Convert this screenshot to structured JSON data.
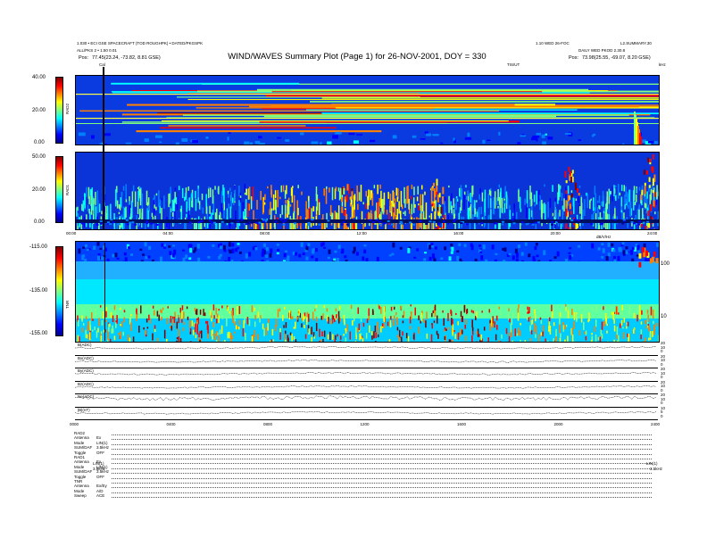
{
  "header": {
    "title": "WIND/WAVES Summary Plot (Page 1) for 26-NOV-2001, DOY = 330",
    "top_left_line1": "1.030 • ECI GSE SPACECRAFT (TOD ROUGHPK) • DATED/PKGSPK",
    "top_left_line2": "ALL/PKS 2 • 1.50 0.01",
    "pos_left_label": "Pos:",
    "pos_left_value": "77.45(23.24, -73.82, 8.81 GSE)",
    "top_right_line1": "1.10 WED 26-FOC",
    "top_right_line1b": "L2.SUMMARY.30",
    "top_right_line2": "DAILY WED PKOD 2.30.8",
    "pos_right_label": "Pos:",
    "pos_right_value": "73.98(25.55, -69.07, 8.20 GSE)",
    "cal_label": "Cal",
    "ticker_label": "TIS/UT",
    "right_unit": "kHz",
    "rad2_right_unit": "MHz"
  },
  "colors": {
    "spectrum": [
      "#00008f",
      "#0000ff",
      "#0080ff",
      "#00ffff",
      "#80ff80",
      "#ffff00",
      "#ff8000",
      "#ff0000",
      "#800000"
    ],
    "panel_bg": "#0a2fd8"
  },
  "chart_data": [
    {
      "type": "heatmap",
      "panel": "RAD2",
      "ylabel": "RAD2",
      "colorbar_ticks": [
        "40.00",
        "20.00",
        "0.00"
      ],
      "right_ticks": [],
      "features": [
        "horizontal interference lines",
        "Type III burst near 22:40"
      ]
    },
    {
      "type": "heatmap",
      "panel": "RAD1",
      "ylabel": "RAD1",
      "colorbar_ticks": [
        "50.00",
        "20.00",
        "0.00"
      ],
      "x_ticks": [
        "00:00",
        "04:00",
        "08:00",
        "12:00",
        "16:00",
        "20:00",
        "24:00"
      ],
      "features": [
        "bursts at 11:00, 15:30, 23:40"
      ]
    },
    {
      "type": "heatmap",
      "panel": "TNR",
      "ylabel": "TNR",
      "colorbar_ticks": [
        "-115.00",
        "-135.00",
        "-155.00"
      ],
      "right_ticks": [
        "100",
        "10"
      ],
      "corner_label": "dB/V/Hz"
    },
    {
      "type": "line",
      "panels": [
        {
          "label": "B(ADC)",
          "right_ticks": [
            "20",
            "10",
            "0"
          ]
        },
        {
          "label": "Bx(ADC)",
          "right_ticks": [
            "20",
            "10",
            "0"
          ]
        },
        {
          "label": "By(ADC)",
          "right_ticks": [
            "20",
            "10",
            "0"
          ]
        },
        {
          "label": "Bz(ADC)",
          "right_ticks": [
            "20",
            "10",
            "0"
          ]
        },
        {
          "label": "Ne(ADC)",
          "right_ticks": [
            "20",
            "10",
            "0"
          ]
        },
        {
          "label": "|B|(nT)",
          "right_ticks": [
            "10",
            "5",
            "0"
          ]
        }
      ],
      "x_ticks": [
        "0000",
        "0400",
        "0800",
        "1200",
        "1600",
        "2000",
        "2400"
      ]
    }
  ],
  "footer": {
    "rows": [
      {
        "label": "RAD2",
        "value": ""
      },
      {
        "label": "Antenna",
        "value": "Ex"
      },
      {
        "label": "Mode",
        "value": "LIN(1)"
      },
      {
        "label": "SUM/DAF",
        "value": "3.5kHz"
      },
      {
        "label": "Toggle",
        "value": "OFF"
      },
      {
        "label": "RAD1",
        "value": ""
      },
      {
        "label": "Antenna",
        "value": "Ex"
      },
      {
        "label": "Mode",
        "value": "LIN(1)"
      },
      {
        "label": "SUM/DAF",
        "value": "3.5kHz"
      },
      {
        "label": "Toggle",
        "value": "OFF"
      },
      {
        "label": "TNR",
        "value": ""
      },
      {
        "label": "Antenna",
        "value": "Ex/Ey"
      },
      {
        "label": "Mode",
        "value": "A/D"
      },
      {
        "label": "Sweep",
        "value": "ACE"
      }
    ],
    "rad1_mode_mid": "LIN(1)",
    "rad1_sum_mid": "3.5kHz",
    "rad1_mode_right": "LIN(1)",
    "rad1_sum_right": "3.5kHz"
  }
}
